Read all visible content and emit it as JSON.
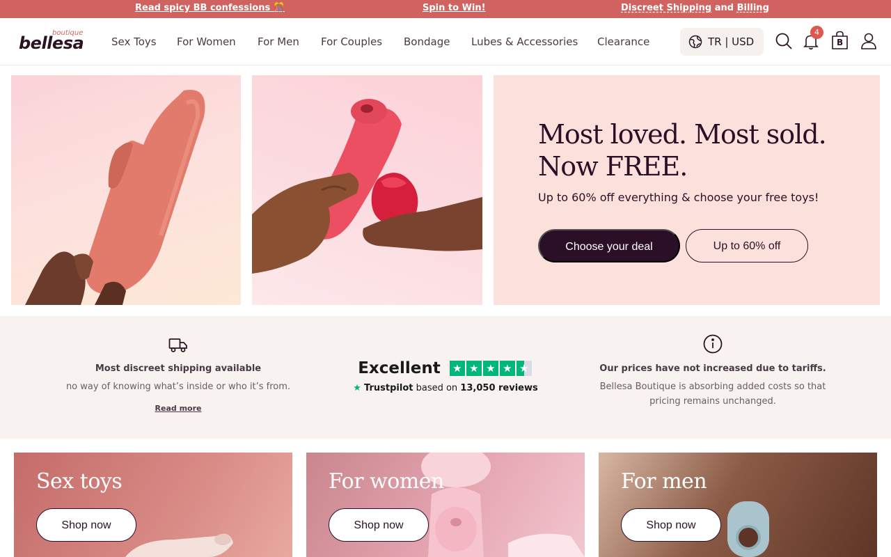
{
  "promo": {
    "link1": "Read spicy BB confessions 🎊",
    "link2": "Spin to Win!",
    "link3_a": "Discreet Shipping",
    "link3_and": " and ",
    "link3_b": "Billing"
  },
  "header": {
    "logo_main": "bellesa",
    "logo_sub": "boutique",
    "nav": [
      "Sex Toys",
      "For Women",
      "For Men",
      "For Couples",
      "Bondage",
      "Lubes & Accessories",
      "Clearance"
    ],
    "locale": "TR | USD",
    "notification_count": "4",
    "bag_letter": "B"
  },
  "hero": {
    "title_line1": "Most loved. Most sold.",
    "title_line2": "Now FREE.",
    "subtitle": "Up to 60% off everything & choose your free toys!",
    "primary_button": "Choose your deal",
    "secondary_button": "Up to 60% off"
  },
  "info": {
    "shipping_title": "Most discreet shipping available",
    "shipping_desc": "no way of knowing what’s inside or who it’s from.",
    "shipping_link": "Read more",
    "rating_word": "Excellent",
    "rating_stars": 4.5,
    "trustpilot_brand": "Trustpilot",
    "trustpilot_text": "based on",
    "trustpilot_count": "13,050 reviews",
    "tariff_title": "Our prices have not increased due to tariffs.",
    "tariff_desc_1": "Bellesa Boutique is absorbing added costs so that",
    "tariff_desc_2": "pricing remains unchanged."
  },
  "categories": [
    {
      "title": "Sex toys",
      "button": "Shop now"
    },
    {
      "title": "For women",
      "button": "Shop now"
    },
    {
      "title": "For men",
      "button": "Shop now"
    }
  ],
  "colors": {
    "promo_bg": "#d0635f",
    "brand_dark": "#2b0f26",
    "hero_bg": "#fce0dc",
    "trustpilot_green": "#00b67a",
    "badge_red": "#e0574f"
  }
}
